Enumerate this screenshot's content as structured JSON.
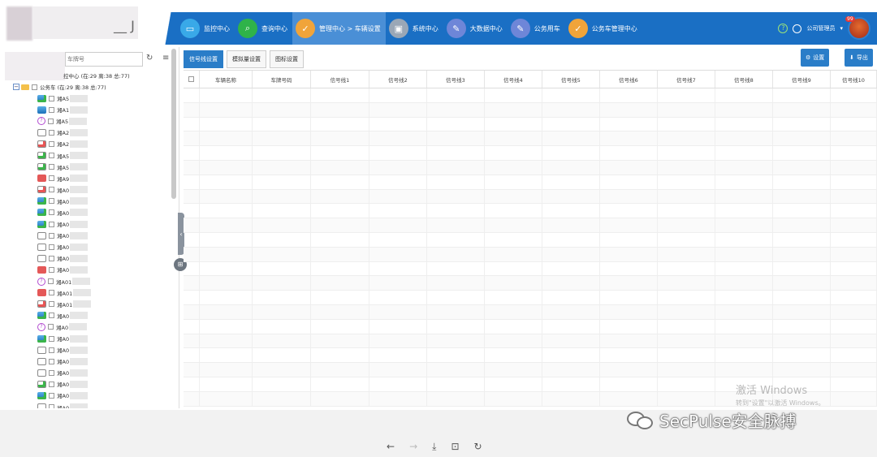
{
  "header": {
    "logo_text": "__ J",
    "nav": [
      {
        "label": "监控中心",
        "icon": "monitor-icon",
        "color": "#39a9e8"
      },
      {
        "label": "查询中心",
        "icon": "search-icon",
        "color": "#2fb34a"
      },
      {
        "label": "管理中心 > 车辆设置",
        "icon": "check-icon",
        "color": "#f0a43a",
        "active": true
      },
      {
        "label": "系统中心",
        "icon": "screen-icon",
        "color": "#9aa7b6"
      },
      {
        "label": "大数据中心",
        "icon": "edit-icon",
        "color": "#6e86d8"
      },
      {
        "label": "公务用车",
        "icon": "edit-icon",
        "color": "#6e86d8"
      },
      {
        "label": "公务车管理中心",
        "icon": "check-icon",
        "color": "#f0a43a"
      }
    ],
    "help": "?",
    "user_label": "公司管理员",
    "notif_count": "99"
  },
  "sidebar": {
    "search_placeholder": "车牌号",
    "root_label": "控中心 (在:29 离:38 总:77)",
    "group_label": "公务车 (在:29 离:38 总:77)",
    "vehicles": [
      {
        "name": "湘A5",
        "icon": "bluegreen"
      },
      {
        "name": "湘A1",
        "icon": "blue"
      },
      {
        "name": "湘A5",
        "icon": "purple"
      },
      {
        "name": "湘A2",
        "icon": "gray"
      },
      {
        "name": "湘A2",
        "icon": "grayred"
      },
      {
        "name": "湘A5",
        "icon": "graygreen"
      },
      {
        "name": "湘A5",
        "icon": "graygreen"
      },
      {
        "name": "湘A9",
        "icon": "red"
      },
      {
        "name": "湘A0",
        "icon": "grayred"
      },
      {
        "name": "湘A0",
        "icon": "bluegreen"
      },
      {
        "name": "湘A0",
        "icon": "bluegreen"
      },
      {
        "name": "湘A0",
        "icon": "bluegreen"
      },
      {
        "name": "湘A0",
        "icon": "gray"
      },
      {
        "name": "湘A0",
        "icon": "gray"
      },
      {
        "name": "湘A0",
        "icon": "gray"
      },
      {
        "name": "湘A0",
        "icon": "red"
      },
      {
        "name": "湘A01",
        "icon": "purple"
      },
      {
        "name": "湘A01",
        "icon": "red"
      },
      {
        "name": "湘A01",
        "icon": "grayred"
      },
      {
        "name": "湘A0",
        "icon": "bluegreen"
      },
      {
        "name": "湘A0",
        "icon": "purple"
      },
      {
        "name": "湘A0",
        "icon": "bluegreen"
      },
      {
        "name": "湘A0",
        "icon": "gray"
      },
      {
        "name": "湘A0",
        "icon": "gray"
      },
      {
        "name": "湘A0",
        "icon": "gray"
      },
      {
        "name": "湘A0",
        "icon": "graygreen"
      },
      {
        "name": "湘A0",
        "icon": "bluegreen"
      },
      {
        "name": "湘A0",
        "icon": "gray"
      }
    ]
  },
  "content": {
    "tabs": [
      "信号线设置",
      "模拟量设置",
      "图标设置"
    ],
    "settings_btn": "设置",
    "export_btn": "导出",
    "columns": [
      "车辆名称",
      "车牌号码",
      "信号线1",
      "信号线2",
      "信号线3",
      "信号线4",
      "信号线5",
      "信号线6",
      "信号线7",
      "信号线8",
      "信号线9",
      "信号线10"
    ]
  },
  "watermark": {
    "windows_l1": "激活 Windows",
    "windows_l2": "转到\"设置\"以激活 Windows。",
    "brand": "SecPulse安全脉搏"
  }
}
